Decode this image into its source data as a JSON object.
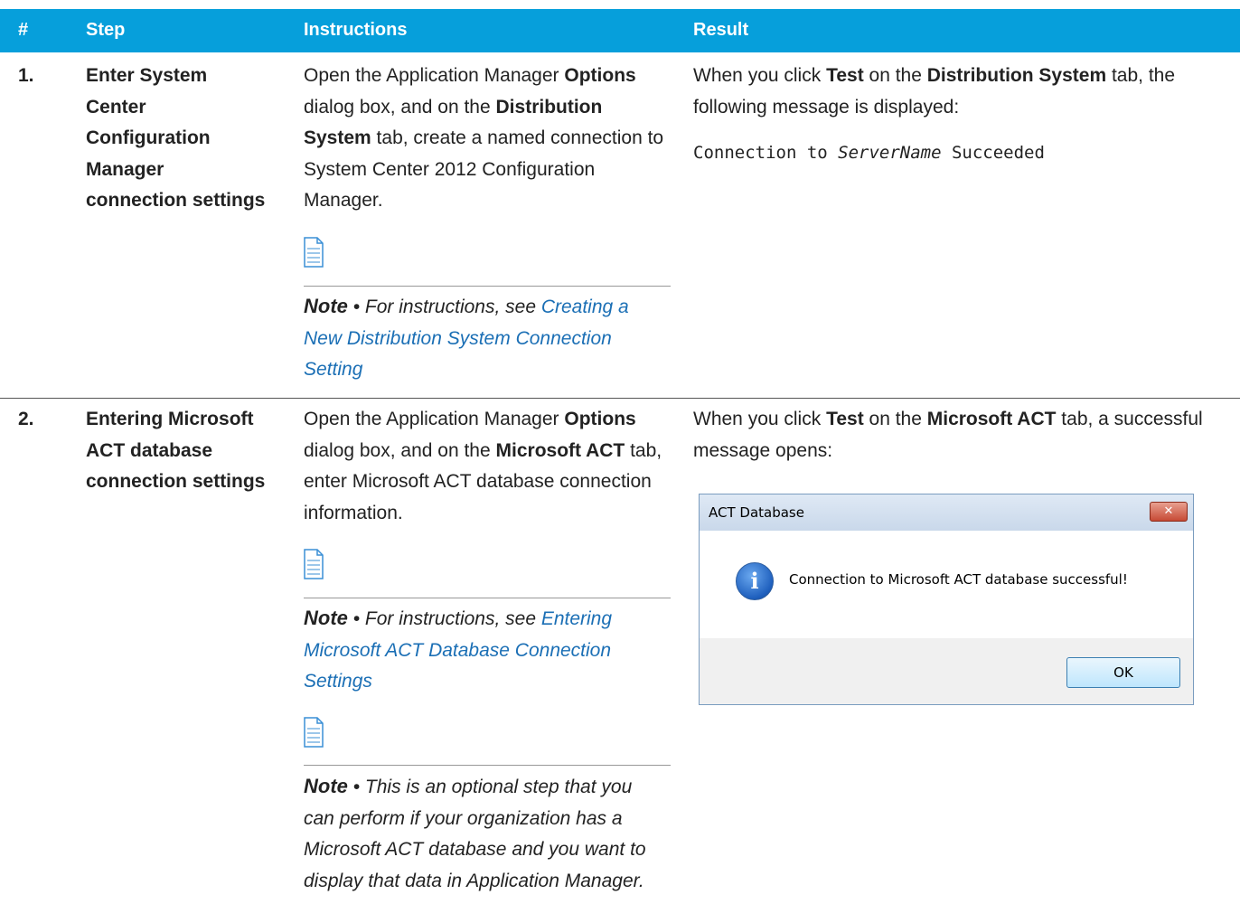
{
  "header": {
    "col_num": "#",
    "col_step": "Step",
    "col_instructions": "Instructions",
    "col_result": "Result"
  },
  "rows": [
    {
      "num": "1.",
      "step": [
        "Enter System",
        "Center",
        "Configuration",
        "Manager",
        "connection settings"
      ],
      "instructions_parts": {
        "open": "Open the Application Manager ",
        "options": "Options",
        "dialog": " dialog box, and on the ",
        "dist": "Distribution",
        "system": "System",
        "rest": " tab, create a named connection to System Center 2012 Configuration Manager."
      },
      "note": {
        "label": "Note",
        "sep": " • ",
        "text": "For instructions, see ",
        "link": "Creating a New Distribution System Connection Setting"
      },
      "result_parts": {
        "a": "When you click ",
        "test": "Test",
        "b": " on the ",
        "dist_system": "Distribution System",
        "c": " tab, the following message is displayed:"
      },
      "message": {
        "prefix": "Connection to ",
        "server": "ServerName",
        "suffix": " Succeeded"
      }
    },
    {
      "num": "2.",
      "step": [
        "Entering Microsoft",
        "ACT database",
        "connection settings"
      ],
      "instructions_parts": {
        "open": "Open the Application Manager ",
        "options": "Options",
        "dialog": " dialog box, and on the ",
        "msact": "Microsoft ACT",
        "rest": " tab, enter Microsoft ACT database connection information."
      },
      "note1": {
        "label": "Note",
        "sep": " • ",
        "text": "For instructions, see ",
        "link": "Entering Microsoft ACT Database Connection Settings"
      },
      "note2": {
        "label": "Note",
        "sep": " • ",
        "text": "This is an optional step that you can perform if your organization has a Microsoft ACT database and you want to display that data in Application Manager."
      },
      "result_parts": {
        "a": "When you click ",
        "test": "Test",
        "b": " on the ",
        "msact": "Microsoft ACT",
        "c": " tab, a successful message opens:"
      },
      "dialog": {
        "title": "ACT Database",
        "close": "✕",
        "icon": "info-icon",
        "message": "Connection to Microsoft ACT database successful!",
        "ok": "OK"
      }
    }
  ],
  "colors": {
    "header_bg": "#069fdb",
    "link": "#1b6fb5"
  }
}
